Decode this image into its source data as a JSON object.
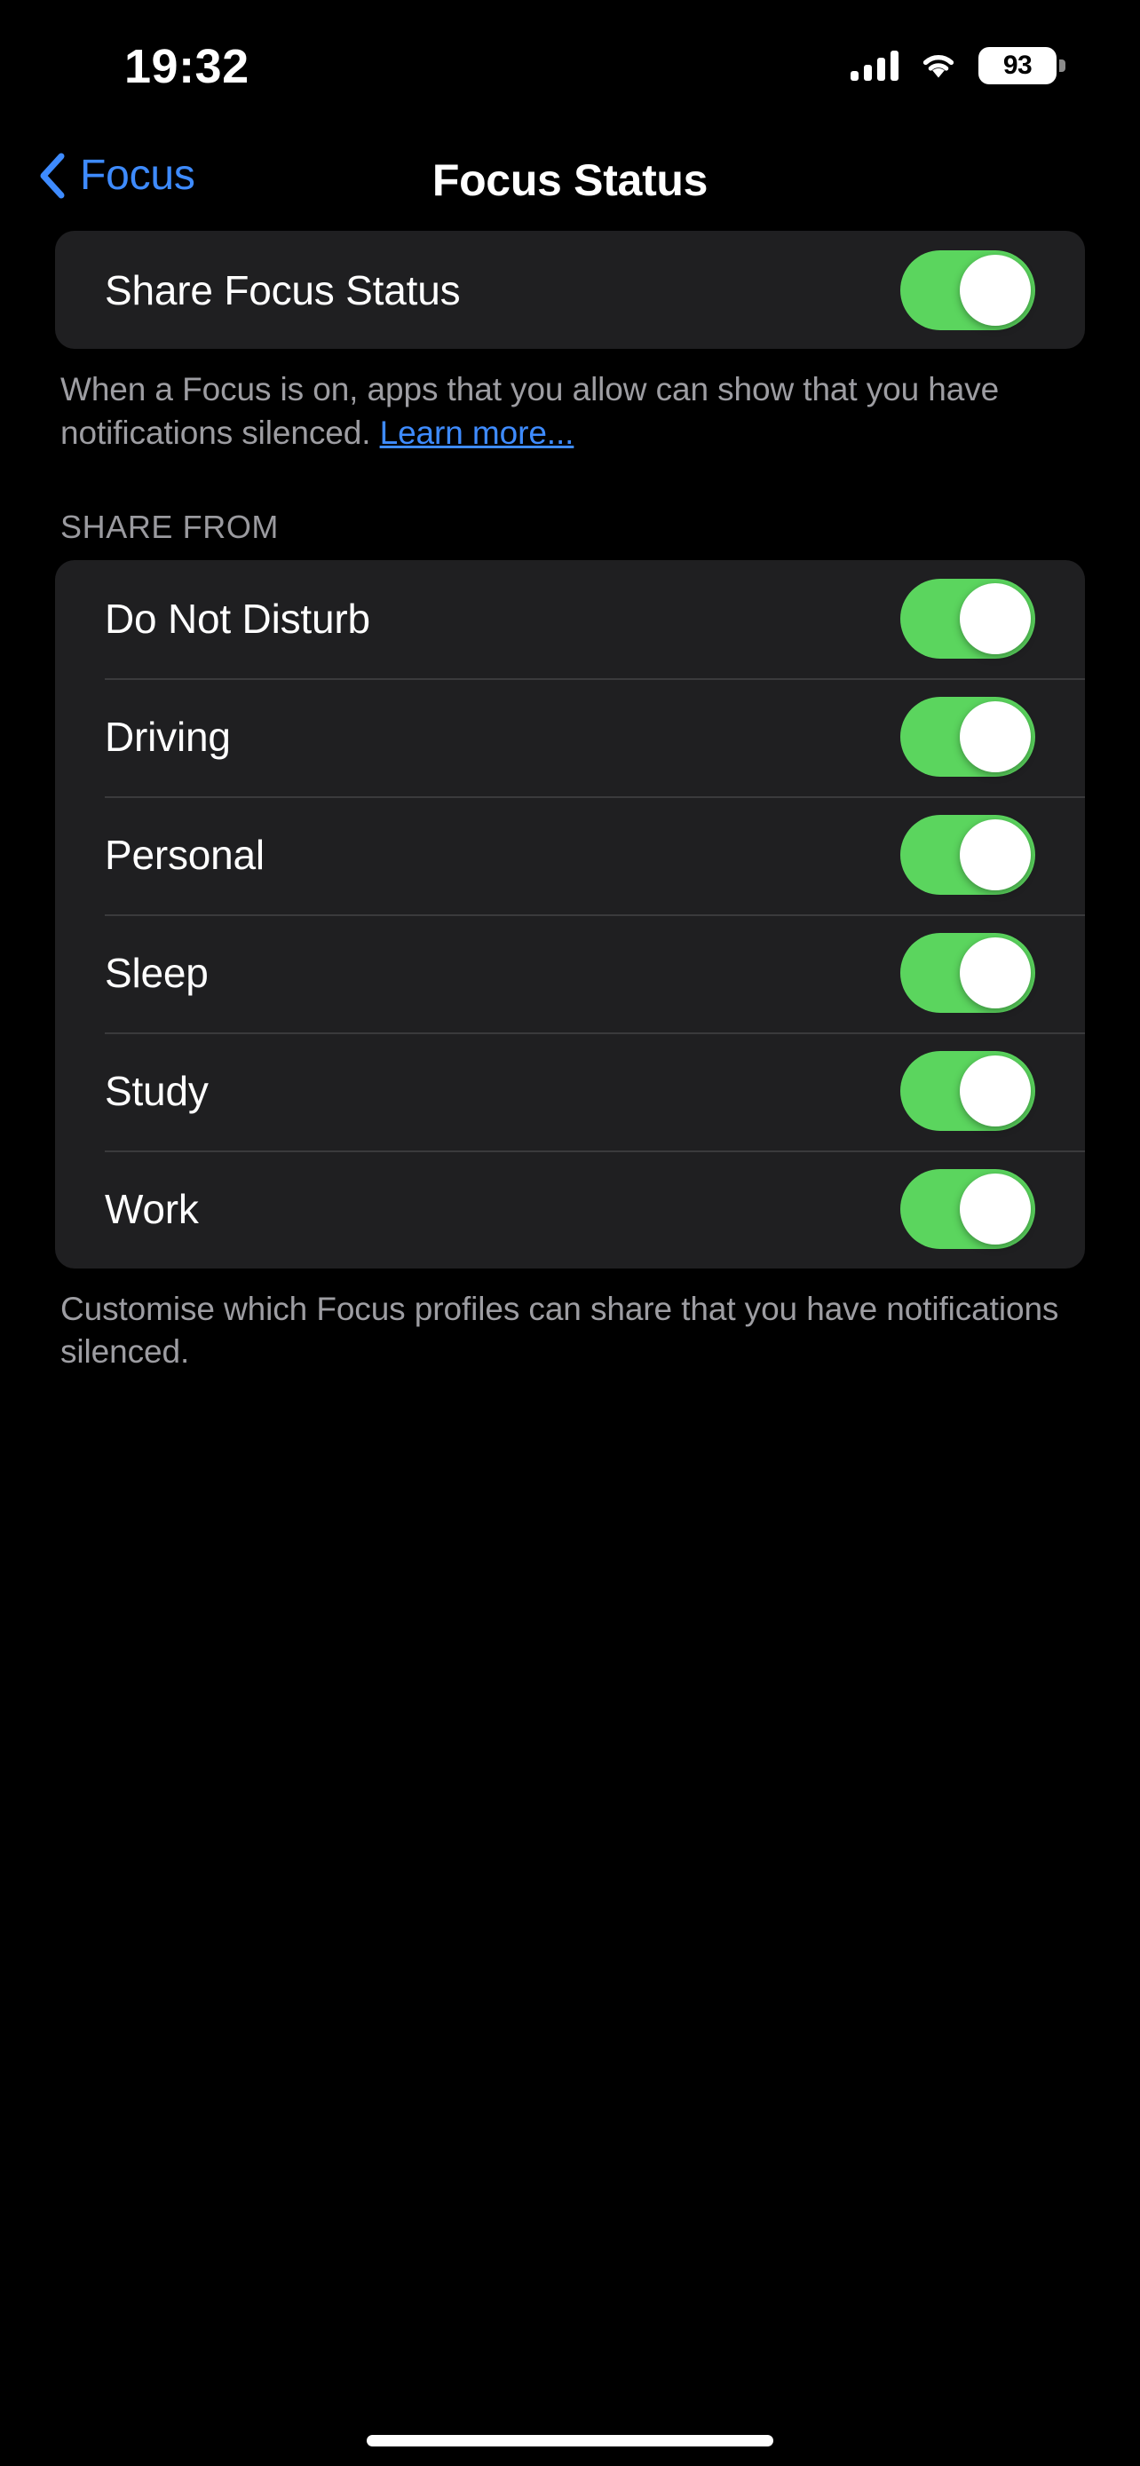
{
  "status_bar": {
    "time": "19:32",
    "cellular_icon": "cellular-bars-icon",
    "cellular_bars": 4,
    "wifi_icon": "wifi-icon",
    "battery_icon": "battery-icon",
    "battery_percent": "93"
  },
  "nav_bar": {
    "back_icon": "chevron-left-icon",
    "back_label": "Focus",
    "title": "Focus Status"
  },
  "main_toggle_section": {
    "row": {
      "label": "Share Focus Status",
      "toggle_on": true
    },
    "footer": {
      "text": "When a Focus is on, apps that you allow can show that you have notifications silenced. ",
      "link_label": "Learn more..."
    }
  },
  "share_from_section": {
    "header": "SHARE FROM",
    "rows": [
      {
        "label": "Do Not Disturb",
        "toggle_on": true
      },
      {
        "label": "Driving",
        "toggle_on": true
      },
      {
        "label": "Personal",
        "toggle_on": true
      },
      {
        "label": "Sleep",
        "toggle_on": true
      },
      {
        "label": "Study",
        "toggle_on": true
      },
      {
        "label": "Work",
        "toggle_on": true
      }
    ],
    "footer": {
      "text": "Customise which Focus profiles can share that you have notifications silenced."
    }
  },
  "home_indicator": "home-indicator",
  "colors": {
    "background": "#000000",
    "card": "#1F1F21",
    "separator": "#3A3A3C",
    "toggle_on": "#5BD55E",
    "toggle_knob": "#FFFFFF",
    "accent_blue": "#3E8BFF",
    "secondary_text": "#9D9DA2",
    "primary_text": "#FFFFFF"
  }
}
